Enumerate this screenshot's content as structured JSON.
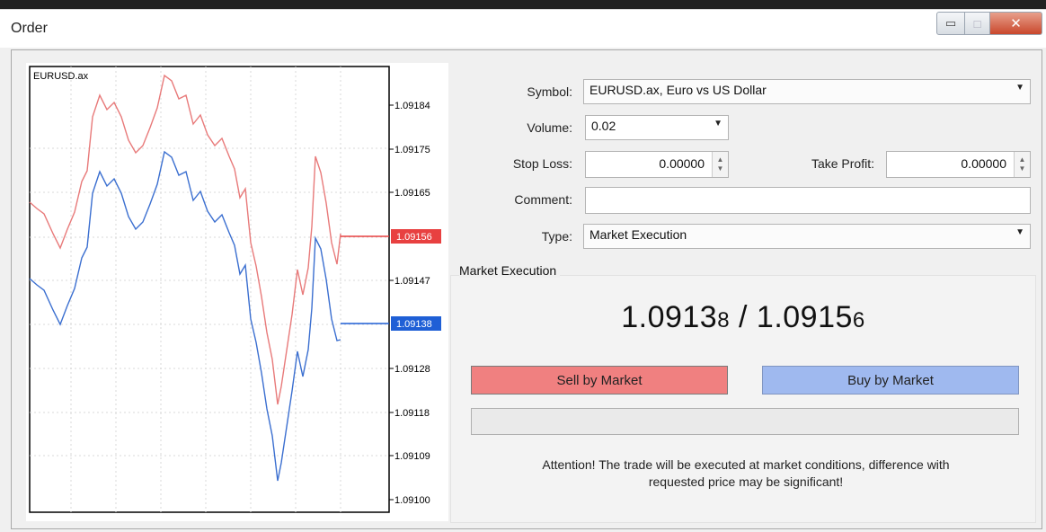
{
  "window": {
    "title": "Order",
    "min_glyph": "▭",
    "max_glyph": "□",
    "close_glyph": "✕"
  },
  "chart": {
    "symbol_label": "EURUSD.ax",
    "price_ticks": [
      "1.09184",
      "1.09175",
      "1.09165",
      "1.09147",
      "1.09128",
      "1.09118",
      "1.09109",
      "1.09100"
    ],
    "ask_marker": "1.09156",
    "bid_marker": "1.09138",
    "ask_color": "#e87a7a",
    "bid_color": "#3b6fd0",
    "ask_marker_color": "#e84040",
    "bid_marker_color": "#1f5fd6"
  },
  "form": {
    "symbol_label": "Symbol:",
    "symbol_value": "EURUSD.ax, Euro vs US Dollar",
    "volume_label": "Volume:",
    "volume_value": "0.02",
    "stop_loss_label": "Stop Loss:",
    "stop_loss_value": "0.00000",
    "take_profit_label": "Take Profit:",
    "take_profit_value": "0.00000",
    "comment_label": "Comment:",
    "comment_value": "",
    "type_label": "Type:",
    "type_value": "Market Execution"
  },
  "market": {
    "group_title": "Market Execution",
    "bid_main": "1.0913",
    "bid_small": "8",
    "separator": " / ",
    "ask_main": "1.0915",
    "ask_small": "6",
    "sell_label": "Sell by Market",
    "buy_label": "Buy by Market",
    "sell_color": "#f08080",
    "buy_color": "#9fb9ef",
    "progress": 0,
    "attention_line1": "Attention! The trade will be executed at market conditions, difference with",
    "attention_line2": "requested price may be significant!"
  }
}
